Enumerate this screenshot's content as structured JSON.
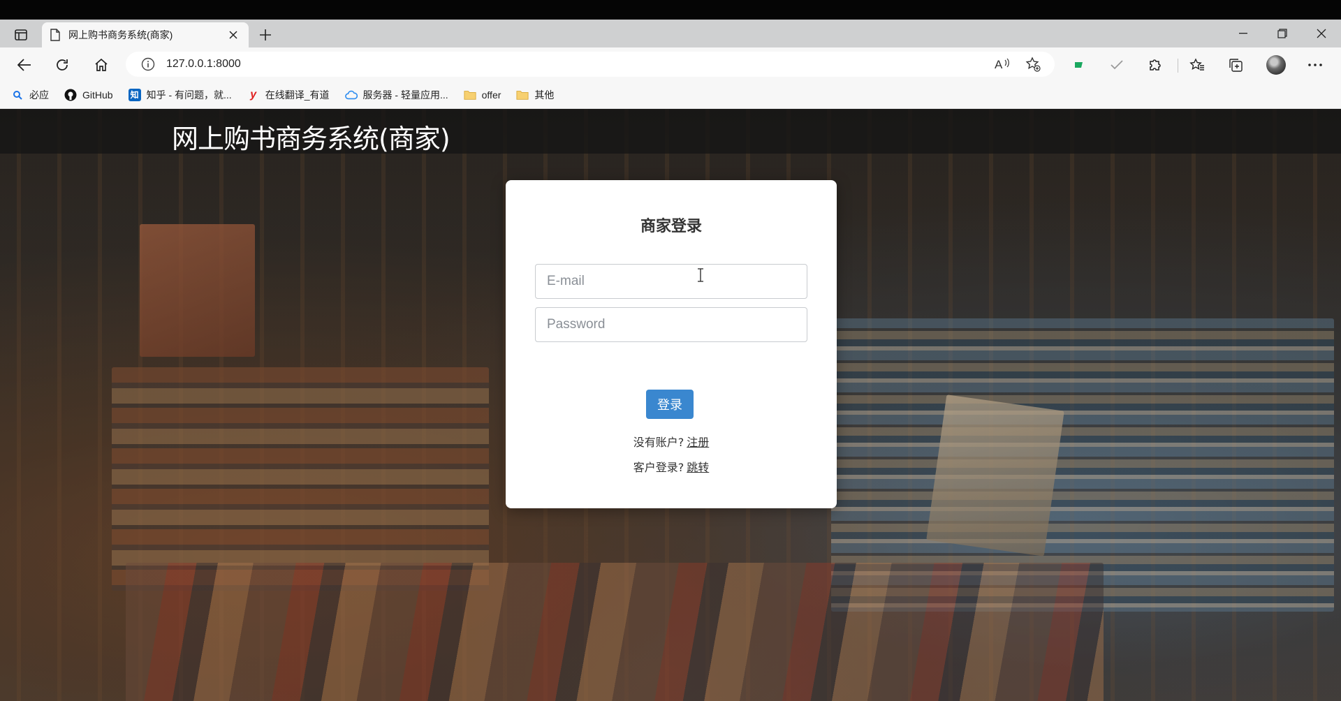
{
  "browser": {
    "tab": {
      "title": "网上购书商务系统(商家)"
    },
    "address": {
      "url": "127.0.0.1:8000"
    },
    "bookmarks": [
      {
        "label": "必应",
        "icon": "bing-icon",
        "color": "#1a73e8"
      },
      {
        "label": "GitHub",
        "icon": "github-icon",
        "color": "#111111"
      },
      {
        "label": "知乎 - 有问题，就...",
        "icon": "zhihu-icon",
        "color": "#0a66c2"
      },
      {
        "label": "在线翻译_有道",
        "icon": "youdao-icon",
        "color": "#e02020"
      },
      {
        "label": "服务器 - 轻量应用...",
        "icon": "cloud-icon",
        "color": "#2d8cf0"
      },
      {
        "label": "offer",
        "icon": "folder-icon",
        "color": "#f2c14e"
      },
      {
        "label": "其他",
        "icon": "folder-icon",
        "color": "#f2c14e"
      }
    ]
  },
  "site": {
    "title": "网上购书商务系统(商家)"
  },
  "login": {
    "heading": "商家登录",
    "email_placeholder": "E-mail",
    "password_placeholder": "Password",
    "submit_label": "登录",
    "register_prompt": "没有账户?",
    "register_link": "注册",
    "customer_prompt": "客户登录?",
    "customer_link": "跳转"
  },
  "colors": {
    "accent": "#3a87cf",
    "header_bg": "#1e1e1e"
  }
}
